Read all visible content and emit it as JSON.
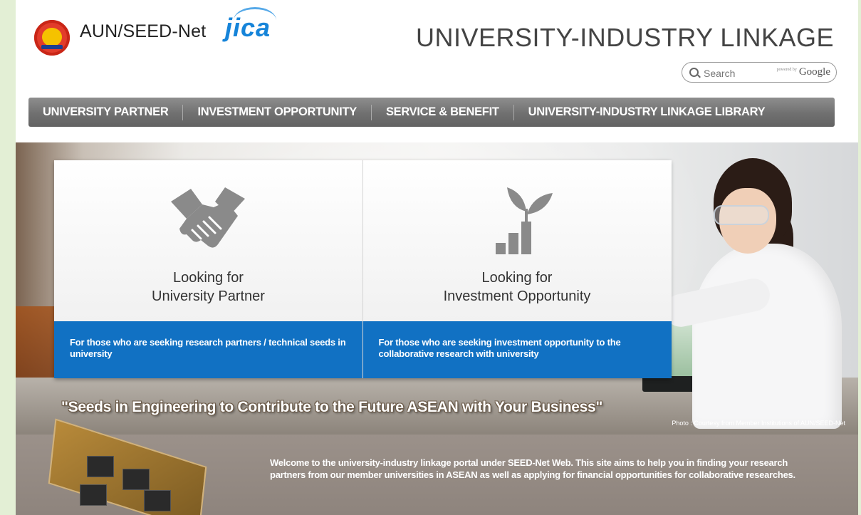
{
  "header": {
    "brand": "AUN/SEED-Net",
    "partner_logo": "jica",
    "site_title": "UNIVERSITY-INDUSTRY LINKAGE",
    "search": {
      "placeholder": "Search",
      "powered_by": "powered by",
      "provider": "Google"
    }
  },
  "nav": {
    "items": [
      {
        "label": "UNIVERSITY PARTNER"
      },
      {
        "label": "INVESTMENT OPPORTUNITY"
      },
      {
        "label": "SERVICE & BENEFIT"
      },
      {
        "label": "UNIVERSITY-INDUSTRY LINKAGE LIBRARY"
      }
    ]
  },
  "hero": {
    "cards": [
      {
        "icon": "handshake-icon",
        "title_line1": "Looking for",
        "title_line2": "University Partner",
        "description": "For those who are seeking research partners / technical seeds in university"
      },
      {
        "icon": "growth-chart-icon",
        "title_line1": "Looking for",
        "title_line2": "Investment Opportunity",
        "description": "For those who are seeking investment opportunity to the collaborative research with university"
      }
    ],
    "tagline": "\"Seeds in Engineering to Contribute to the Future ASEAN with Your Business\"",
    "credit": "Photo : Courtesy from Member Institutions of AUN/SEED-Net"
  },
  "welcome": {
    "text": "Welcome to the university-industry linkage portal under SEED-Net Web. This site aims to help you in finding your research partners from our member universities in ASEAN as well as applying for financial opportunities for collaborative researches."
  },
  "colors": {
    "accent_blue": "#1171c3",
    "nav_gray": "#707070",
    "page_bg": "#e3efd5"
  }
}
